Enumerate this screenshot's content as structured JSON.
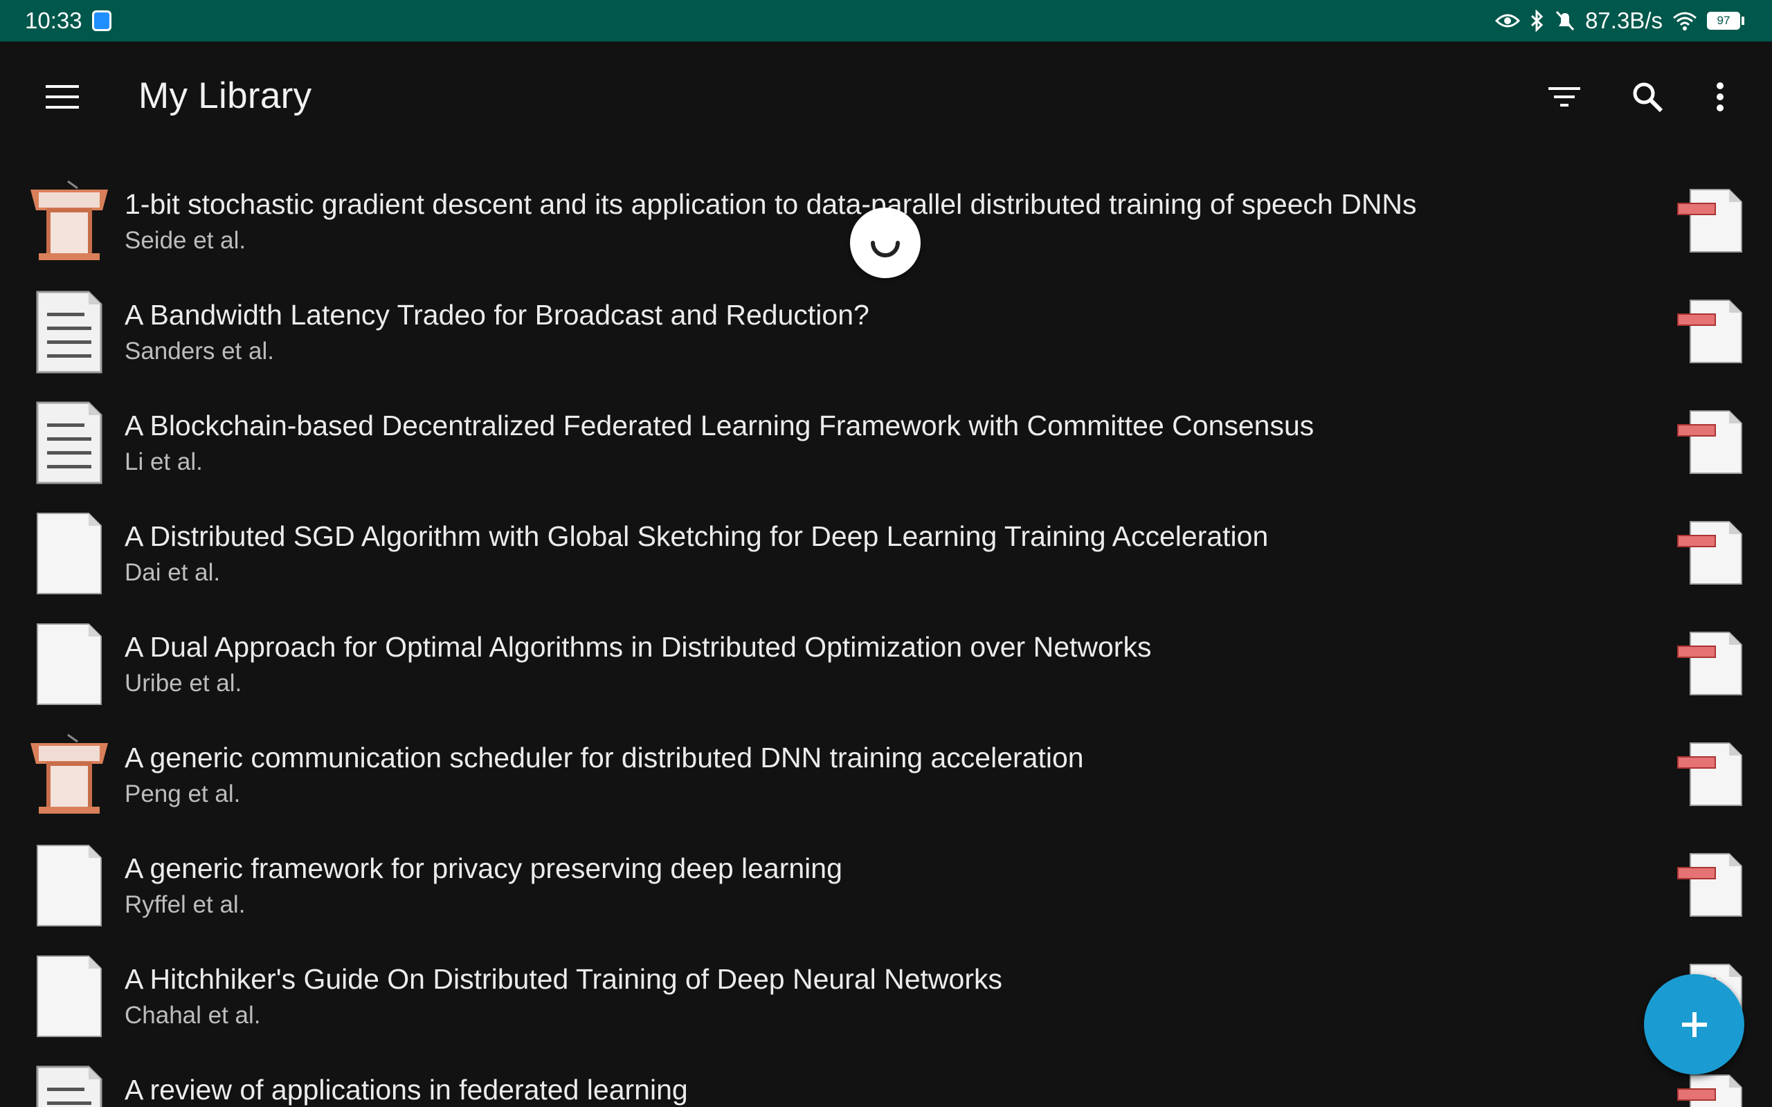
{
  "status_bar": {
    "time": "10:33",
    "network_speed": "87.3B/s",
    "battery": "97"
  },
  "app_bar": {
    "title": "My Library",
    "icons": [
      "menu-icon",
      "filter-icon",
      "search-icon",
      "more-vert-icon"
    ]
  },
  "items": [
    {
      "title": "1-bit stochastic gradient descent and its application to data-parallel distributed training of speech DNNs",
      "authors": "Seide et al.",
      "type": "presentation"
    },
    {
      "title": "A Bandwidth Latency Tradeo for Broadcast and Reduction?",
      "authors": "Sanders et al.",
      "type": "document"
    },
    {
      "title": "A Blockchain-based Decentralized Federated Learning Framework with Committee Consensus",
      "authors": "Li et al.",
      "type": "document"
    },
    {
      "title": "A Distributed SGD Algorithm with Global Sketching for Deep Learning Training Acceleration",
      "authors": "Dai et al.",
      "type": "blank"
    },
    {
      "title": "A Dual Approach for Optimal Algorithms in Distributed Optimization over Networks",
      "authors": "Uribe et al.",
      "type": "blank"
    },
    {
      "title": "A generic communication scheduler for distributed DNN training acceleration",
      "authors": "Peng et al.",
      "type": "presentation"
    },
    {
      "title": "A generic framework for privacy preserving deep learning",
      "authors": "Ryffel et al.",
      "type": "blank"
    },
    {
      "title": "A Hitchhiker's Guide On Distributed Training of Deep Neural Networks",
      "authors": "Chahal et al.",
      "type": "blank"
    },
    {
      "title": "A review of applications in federated learning",
      "authors": "",
      "type": "document"
    }
  ],
  "colors": {
    "status_bar": "#00574b",
    "background": "#121212",
    "fab": "#1a9bd1",
    "pdf_tag": "#e57373"
  }
}
